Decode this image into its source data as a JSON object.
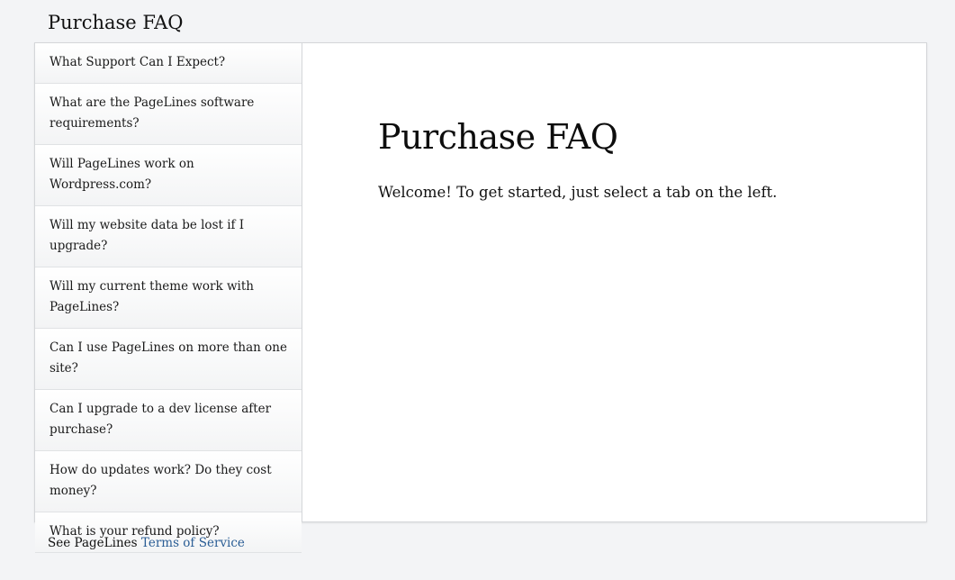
{
  "header": {
    "title": "Purchase FAQ"
  },
  "tabs": [
    {
      "label": "What Support Can I Expect?"
    },
    {
      "label": "What are the PageLines software requirements?"
    },
    {
      "label": "Will PageLines work on Wordpress.com?"
    },
    {
      "label": "Will my website data be lost if I upgrade?"
    },
    {
      "label": "Will my current theme work with PageLines?"
    },
    {
      "label": "Can I use PageLines on more than one site?"
    },
    {
      "label": "Can I upgrade to a dev license after purchase?"
    },
    {
      "label": "How do updates work? Do they cost money?"
    },
    {
      "label": "What is your refund policy?"
    }
  ],
  "content": {
    "title": "Purchase FAQ",
    "welcome": "Welcome! To get started, just select a tab on the left."
  },
  "footer": {
    "prefix": "See PageLines ",
    "link_text": "Terms of Service"
  },
  "colors": {
    "background": "#f3f4f6",
    "link": "#2a5d95",
    "border": "#d4d6d9"
  }
}
